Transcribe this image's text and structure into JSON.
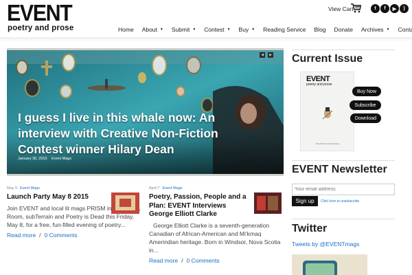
{
  "header": {
    "logo_main": "EVENT",
    "logo_sub": "poetry and prose",
    "view_cart": "View Cart",
    "social": [
      "twitter-icon",
      "facebook-icon",
      "youtube-icon",
      "rss-icon"
    ],
    "nav": [
      {
        "label": "Home",
        "dropdown": false
      },
      {
        "label": "About",
        "dropdown": true
      },
      {
        "label": "Submit",
        "dropdown": true
      },
      {
        "label": "Contest",
        "dropdown": true
      },
      {
        "label": "Buy",
        "dropdown": true
      },
      {
        "label": "Reading Service",
        "dropdown": false
      },
      {
        "label": "Blog",
        "dropdown": false
      },
      {
        "label": "Donate",
        "dropdown": false
      },
      {
        "label": "Archives",
        "dropdown": true
      },
      {
        "label": "Contact",
        "dropdown": true
      }
    ]
  },
  "hero": {
    "title": "I guess I live in this whale now: An interview with Creative Non-Fiction Contest winner Hilary Dean",
    "date": "January 30, 2015",
    "category": "Event Mags"
  },
  "posts": [
    {
      "date": "May 9",
      "category": "Event Mags",
      "title": "Launch Party May 8 2015",
      "excerpt": "Join EVENT and local lit mags PRISM international, Room, subTerrain and Poetry is Dead this Friday, May 8, for a free, fun-filled evening of poetry...",
      "read_more": "Read more",
      "comments": "0 Comments"
    },
    {
      "date": "April 7",
      "category": "Event Mags",
      "title": "Poetry, Passion, People and a Plan: EVENT Interviews George Elliott Clarke",
      "excerpt": "George Elliott Clarke is a seventh-generation Canadian of African-American and Mi’kmaq Amerindian heritage. Born in Windsor, Nova Scotia in...",
      "read_more": "Read more",
      "comments": "0 Comments"
    }
  ],
  "sidebar": {
    "current_issue": {
      "heading": "Current Issue",
      "cover_title": "EVENT",
      "cover_sub": "poetry and prose",
      "cover_foot": "Non-Fiction Contest Issue",
      "buy": "Buy Now",
      "subscribe": "Subscribe",
      "download": "Download"
    },
    "newsletter": {
      "heading": "EVENT Newsletter",
      "placeholder": "Your email address",
      "signup": "Sign up",
      "unsubscribe": "Click here to unsubscribe"
    },
    "twitter": {
      "heading": "Twitter",
      "link": "Tweets by @EVENTmags"
    }
  }
}
